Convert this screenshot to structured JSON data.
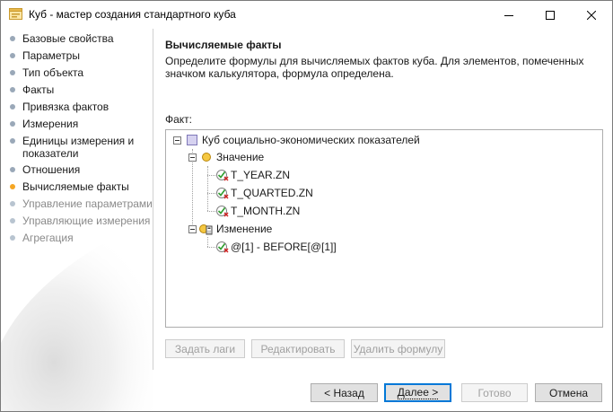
{
  "window": {
    "title": "Куб - мастер создания стандартного куба",
    "icon": "cube-wizard-icon"
  },
  "sidebar": {
    "items": [
      {
        "label": "Базовые свойства",
        "state": "done"
      },
      {
        "label": "Параметры",
        "state": "done"
      },
      {
        "label": "Тип объекта",
        "state": "done"
      },
      {
        "label": "Факты",
        "state": "done"
      },
      {
        "label": "Привязка фактов",
        "state": "done"
      },
      {
        "label": "Измерения",
        "state": "done"
      },
      {
        "label": "Единицы измерения и показатели",
        "state": "done"
      },
      {
        "label": "Отношения",
        "state": "done"
      },
      {
        "label": "Вычисляемые факты",
        "state": "active"
      },
      {
        "label": "Управление параметрами",
        "state": "disabled"
      },
      {
        "label": "Управляющие измерения",
        "state": "disabled"
      },
      {
        "label": "Агрегация",
        "state": "disabled"
      }
    ],
    "colors": {
      "done": "#9aa8b8",
      "active": "#f5a623",
      "disabled": "#b8c4d0"
    }
  },
  "main": {
    "heading": "Вычисляемые факты",
    "description": "Определите формулы для вычисляемых фактов куба. Для элементов, помеченных значком калькулятора, формула определена.",
    "fact_label": "Факт:",
    "tree": {
      "root": {
        "label": "Куб социально-экономических показателей",
        "expanded": true,
        "icon": "cube-icon"
      },
      "groups": [
        {
          "label": "Значение",
          "icon": "fact-folder-icon",
          "expanded": true,
          "children": [
            {
              "label": "T_YEAR.ZN",
              "icon": "fact-check-icon"
            },
            {
              "label": "T_QUARTED.ZN",
              "icon": "fact-check-icon"
            },
            {
              "label": "T_MONTH.ZN",
              "icon": "fact-check-icon"
            }
          ]
        },
        {
          "label": "Изменение",
          "icon": "calculated-fact-folder-icon",
          "expanded": true,
          "children": [
            {
              "label": "@[1] - BEFORE[@[1]]",
              "icon": "fact-check-icon"
            }
          ]
        }
      ]
    },
    "actions": {
      "set_lags": "Задать лаги",
      "edit": "Редактировать",
      "delete_formula": "Удалить формулу"
    }
  },
  "footer": {
    "back": "< Назад",
    "next": "Далее >",
    "done": "Готово",
    "cancel": "Отмена"
  }
}
